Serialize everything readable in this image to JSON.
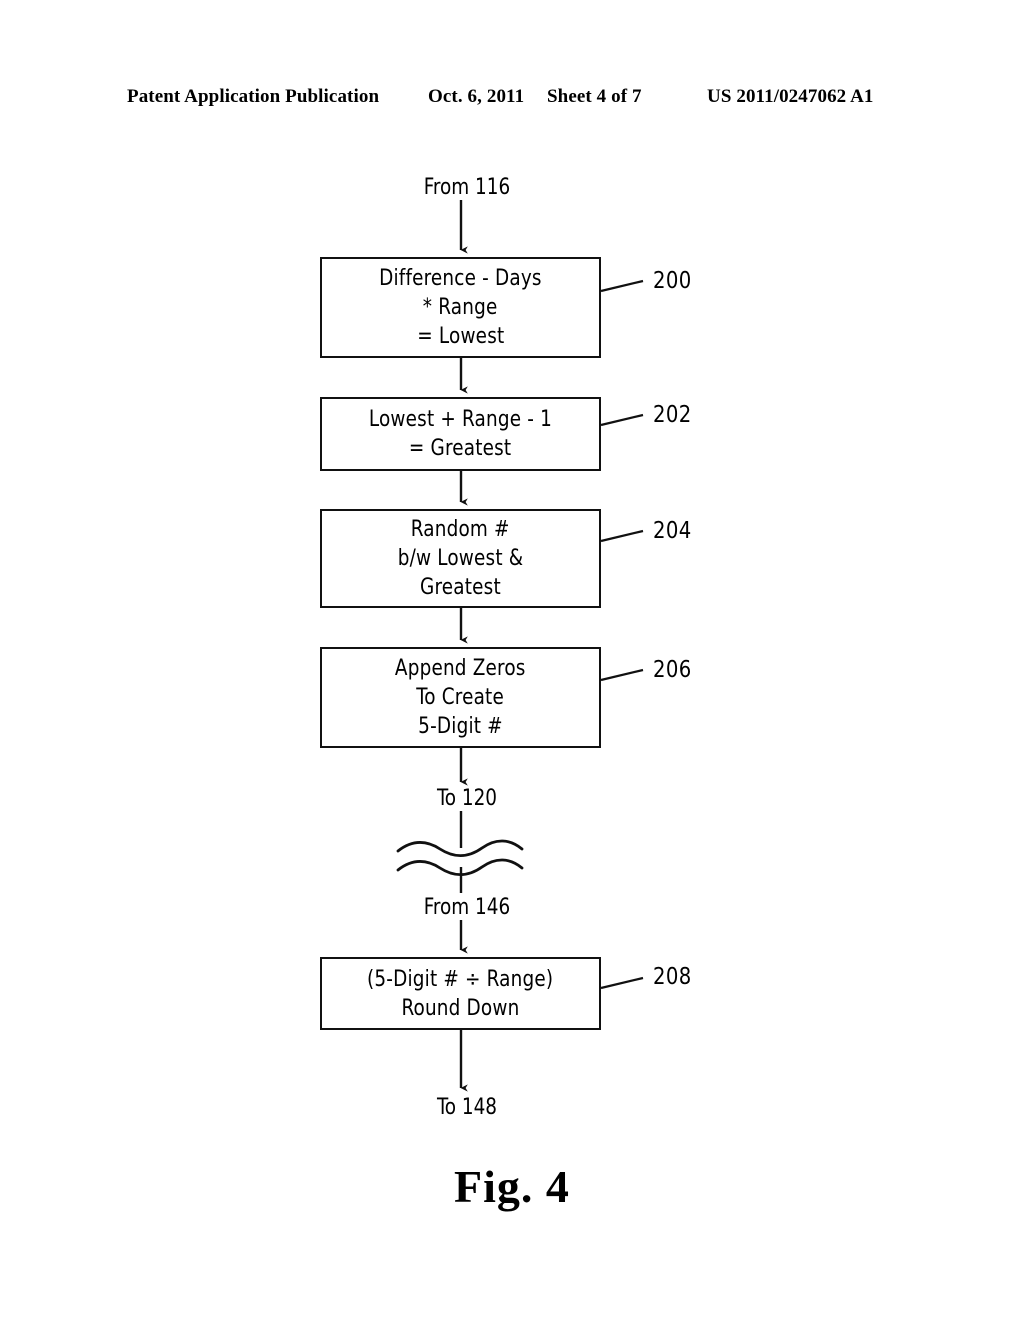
{
  "header": {
    "publication": "Patent Application Publication",
    "date": "Oct. 6, 2011",
    "sheet": "Sheet 4 of 7",
    "patent_number": "US 2011/0247062 A1"
  },
  "figure": {
    "caption": "Fig. 4",
    "entry_label": "From 116",
    "exit_label_top": "To 120",
    "reentry_label": "From 146",
    "exit_label_bottom": "To 148",
    "steps": [
      {
        "ref": "200",
        "lines": [
          "Difference - Days",
          "* Range",
          "= Lowest"
        ]
      },
      {
        "ref": "202",
        "lines": [
          "Lowest + Range - 1",
          "= Greatest"
        ]
      },
      {
        "ref": "204",
        "lines": [
          "Random #",
          "b/w Lowest &",
          "Greatest"
        ]
      },
      {
        "ref": "206",
        "lines": [
          "Append Zeros",
          "To Create",
          "5-Digit #"
        ]
      },
      {
        "ref": "208",
        "lines": [
          "(5-Digit # ÷ Range)",
          "Round Down"
        ]
      }
    ]
  },
  "colors": {
    "ink": "#111111",
    "paper": "#ffffff"
  }
}
